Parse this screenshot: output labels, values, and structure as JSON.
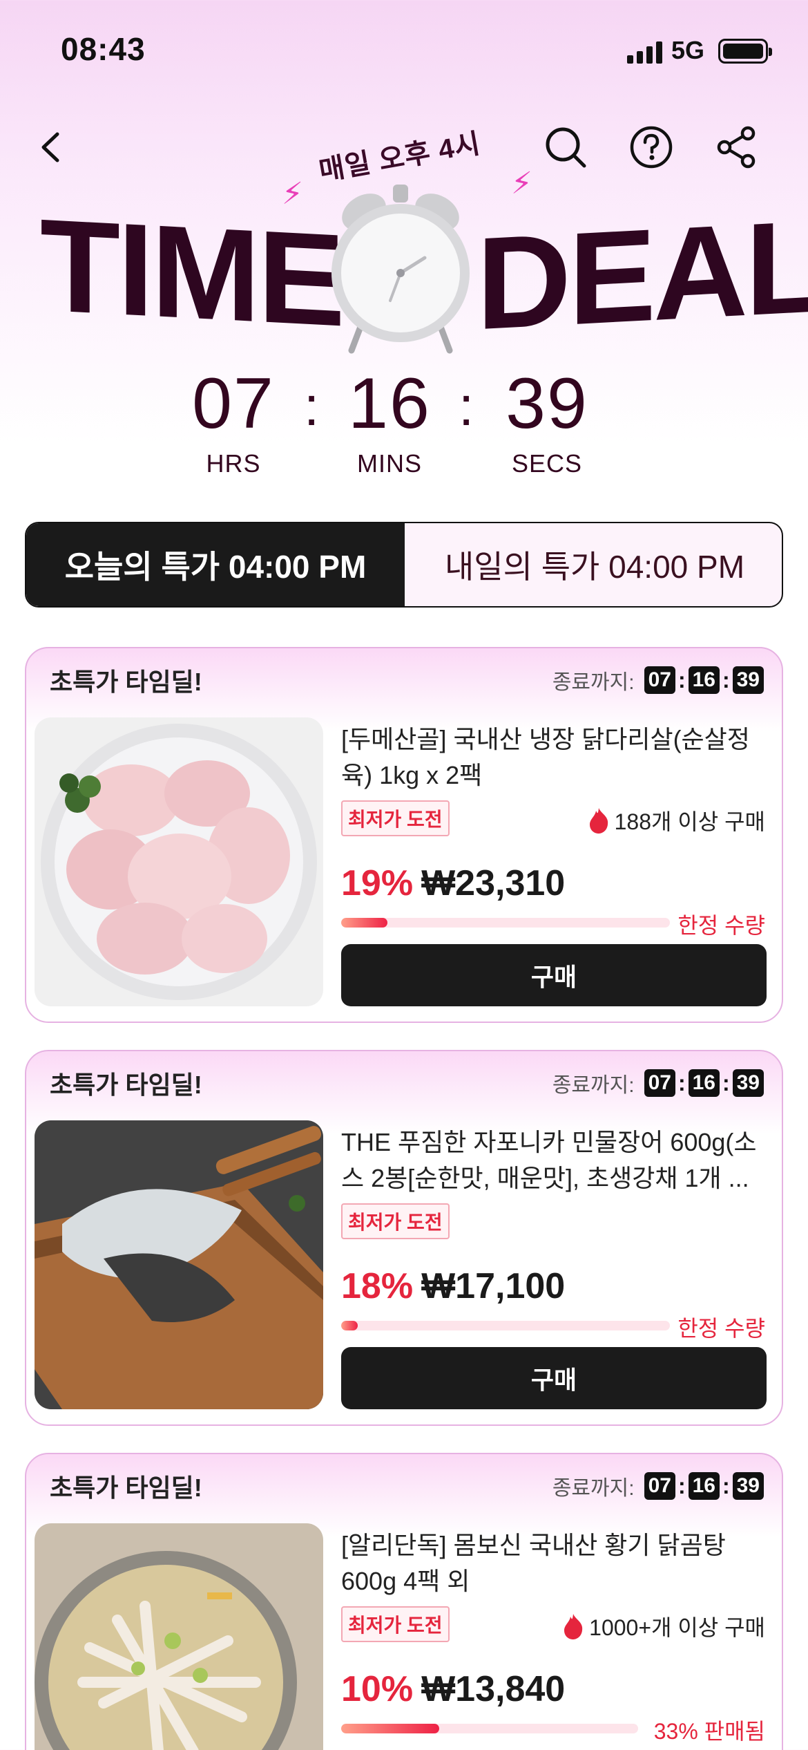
{
  "status_bar": {
    "time": "08:43",
    "network": "5G"
  },
  "hero": {
    "subtitle": "매일 오후 4시",
    "title_left": "TIME",
    "title_right": "DEALS",
    "colors": {
      "title": "#2e0620",
      "accent": "#e93fb8"
    }
  },
  "countdown": {
    "hours": "07",
    "hours_label": "HRS",
    "minutes": "16",
    "minutes_label": "MINS",
    "seconds": "39",
    "seconds_label": "SECS",
    "separator": ":"
  },
  "tabs": [
    {
      "label": "오늘의 특가 04:00 PM",
      "active": true
    },
    {
      "label": "내일의 특가 04:00 PM",
      "active": false
    }
  ],
  "cards": [
    {
      "title": "초특가 타임딜!",
      "timer_label": "종료까지:",
      "timer": [
        "07",
        "16",
        "39"
      ],
      "name": "[두메산골] 국내산 냉장 닭다리살(순살정육) 1kg x 2팩",
      "badge": "최저가 도전",
      "sold": "188개 이상 구매",
      "discount": "19%",
      "price": "₩23,310",
      "progress": 0.14,
      "progress_label": "한정 수량",
      "button": "구매"
    },
    {
      "title": "초특가 타임딜!",
      "timer_label": "종료까지:",
      "timer": [
        "07",
        "16",
        "39"
      ],
      "name": "THE 푸짐한 자포니카 민물장어 600g(소스 2봉[순한맛, 매운맛], 초생강채 1개 ...",
      "badge": "최저가 도전",
      "sold": "",
      "discount": "18%",
      "price": "₩17,100",
      "progress": 0.05,
      "progress_label": "한정 수량",
      "button": "구매"
    },
    {
      "title": "초특가 타임딜!",
      "timer_label": "종료까지:",
      "timer": [
        "07",
        "16",
        "39"
      ],
      "name": "[알리단독] 몸보신 국내산 황기 닭곰탕 600g 4팩 외",
      "badge": "최저가 도전",
      "sold": "1000+개 이상 구매",
      "discount": "10%",
      "price": "₩13,840",
      "progress": 0.33,
      "progress_label": "33% 판매됨",
      "button": "구매"
    }
  ],
  "icons": [
    "back-arrow-icon",
    "search-icon",
    "help-icon",
    "share-icon",
    "alarm-clock-icon",
    "fire-icon"
  ]
}
